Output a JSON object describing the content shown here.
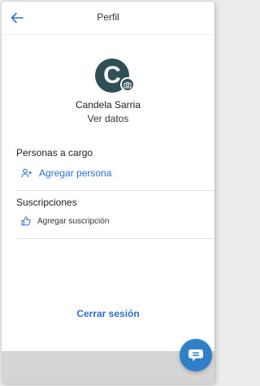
{
  "header": {
    "title": "Perfil",
    "back_icon": "arrow-left-icon"
  },
  "profile": {
    "avatar_initial": "C",
    "name": "Candela Sarria",
    "view_data_label": "Ver datos"
  },
  "dependents": {
    "title": "Personas a cargo",
    "add_label": "Agregar persona",
    "add_icon": "add-person-icon"
  },
  "subscriptions": {
    "title": "Suscripciones",
    "add_label": "Agregar suscripción",
    "add_icon": "thumbs-up-icon"
  },
  "logout_label": "Cerrar sesión",
  "colors": {
    "accent": "#2f6fd1",
    "avatar_bg": "#2f4f55",
    "fab_bg": "#2f80c9",
    "bottom_bar": "#d5d5d5"
  }
}
